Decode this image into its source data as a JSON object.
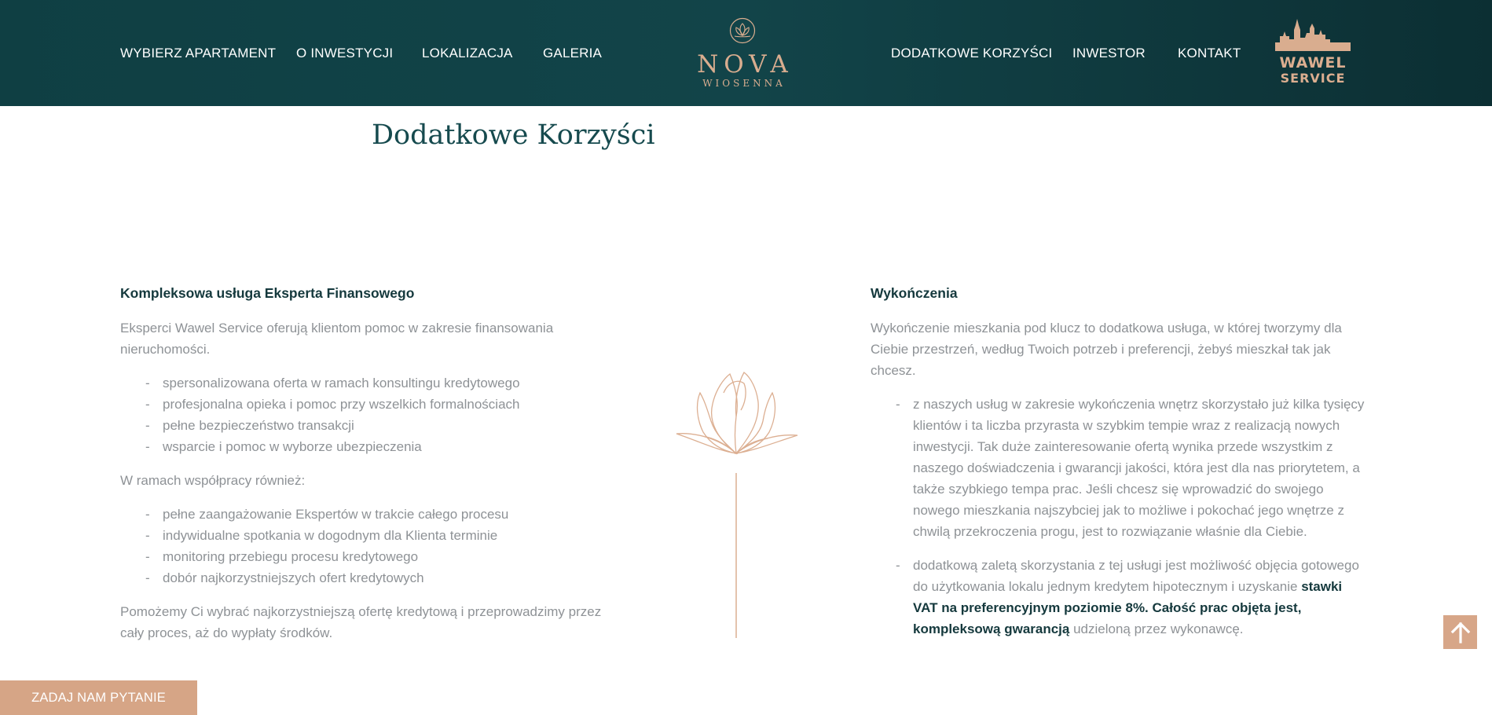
{
  "nav": {
    "left": [
      "WYBIERZ APARTAMENT",
      "O INWESTYCJI",
      "LOKALIZACJA",
      "GALERIA"
    ],
    "right": [
      "DODATKOWE KORZYŚCI",
      "INWESTOR",
      "KONTAKT"
    ]
  },
  "logo": {
    "name": "NOVA",
    "sub": "WIOSENNA",
    "icon": "lotus-emblem-icon"
  },
  "partner_logo": {
    "line1": "WAWEL",
    "line2": "SERVICE",
    "icon": "castle-skyline-icon"
  },
  "colors": {
    "header": "#124449",
    "accent": "#d6a586",
    "heading": "#164a4e",
    "body_text": "#8e9296"
  },
  "page_title": "Dodatkowe Korzyści",
  "left": {
    "heading": "Kompleksowa usługa Eksperta Finansowego",
    "intro": "Eksperci Wawel Service oferują klientom pomoc w zakresie finansowania nieruchomości.",
    "list1": [
      "spersonalizowana oferta w ramach konsultingu kredytowego",
      "profesjonalna opieka i pomoc przy wszelkich formalnościach",
      "pełne bezpieczeństwo transakcji",
      "wsparcie i pomoc w wyborze ubezpieczenia"
    ],
    "middle": "W ramach współpracy również:",
    "list2": [
      "pełne zaangażowanie Ekspertów w trakcie całego procesu",
      "indywidualne spotkania w dogodnym dla Klienta terminie",
      "monitoring przebiegu procesu kredytowego",
      "dobór najkorzystniejszych ofert kredytowych"
    ],
    "outro": "Pomożemy Ci wybrać najkorzystniejszą ofertę kredytową i przeprowadzimy przez cały proces, aż do wypłaty środków."
  },
  "right": {
    "heading": "Wykończenia",
    "intro": "Wykończenie mieszkania pod klucz to dodatkowa usługa, w której tworzymy dla Ciebie przestrzeń, według Twoich potrzeb i preferencji, żebyś mieszkał tak jak chcesz.",
    "item1": "z naszych usług w zakresie wykończenia wnętrz skorzystało już kilka tysięcy klientów i ta liczba przyrasta w szybkim tempie wraz z realizacją nowych inwestycji. Tak duże zainteresowanie ofertą wynika przede wszystkim z naszego doświadczenia i gwarancji jakości, która jest dla nas priorytetem, a także szybkiego tempa prac. Jeśli chcesz się wprowadzić do swojego nowego mieszkania najszybciej jak to możliwe i pokochać jego wnętrze z chwilą przekroczenia progu, jest to rozwiązanie właśnie dla Ciebie.",
    "item2_pre": "dodatkową zaletą skorzystania z tej usługi jest możliwość objęcia gotowego do użytkowania lokalu jednym kredytem hipotecznym i uzyskanie ",
    "item2_bold": "stawki VAT na preferencyjnym poziomie 8%. Całość prac objęta jest, kompleksową gwarancją",
    "item2_post": " udzieloną przez wykonawcę."
  },
  "decor_icon": "crocus-flower-icon",
  "scroll_top_icon": "arrow-up-icon",
  "ask_button": "ZADAJ NAM PYTANIE"
}
